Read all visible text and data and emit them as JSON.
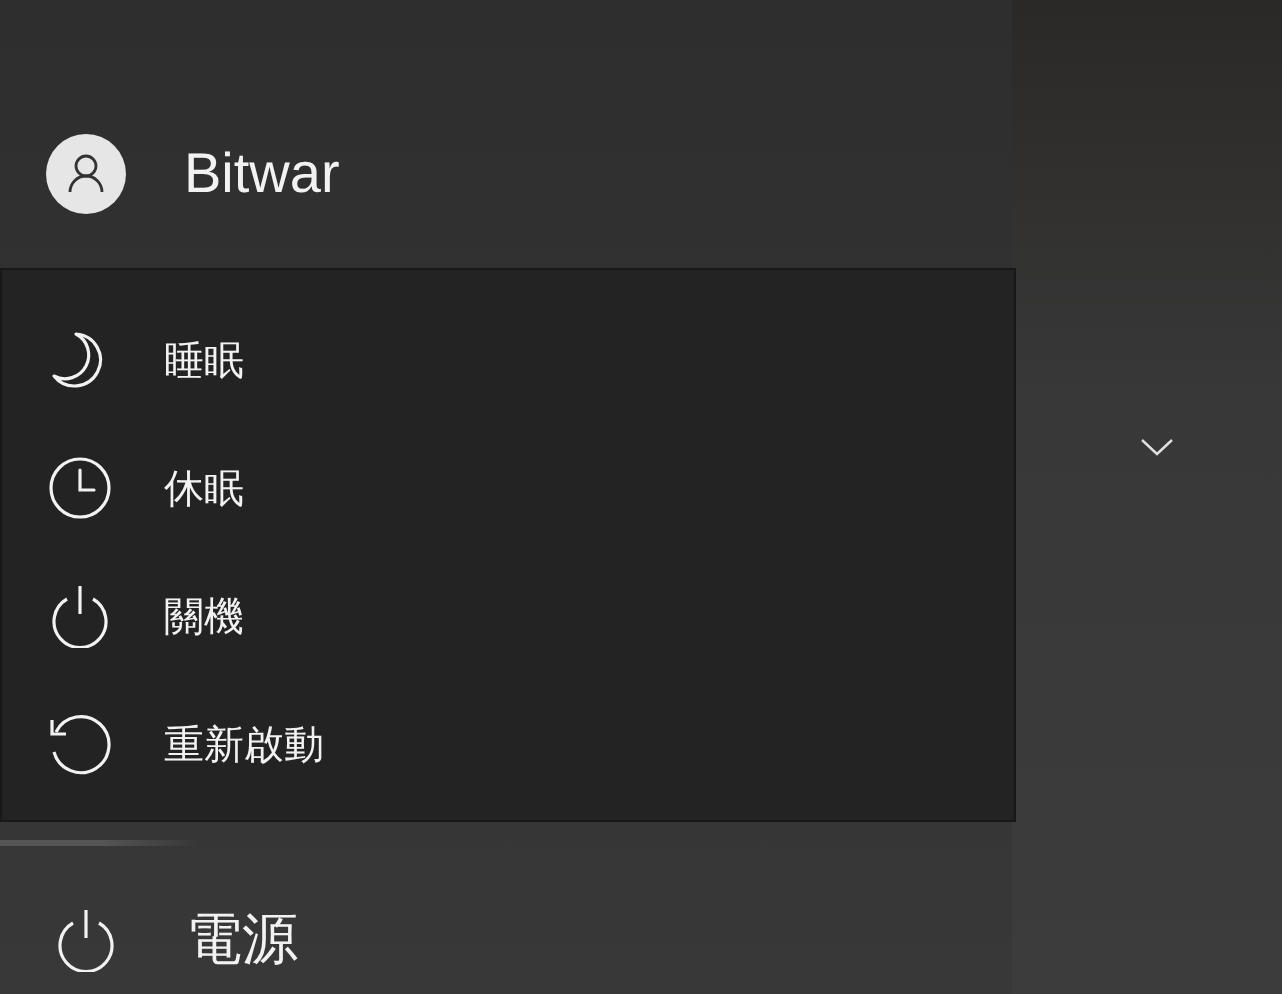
{
  "user": {
    "name": "Bitwar"
  },
  "power_menu": {
    "items": [
      {
        "kind": "sleep",
        "label": "睡眠"
      },
      {
        "kind": "hibernate",
        "label": "休眠"
      },
      {
        "kind": "shutdown",
        "label": "關機"
      },
      {
        "kind": "restart",
        "label": "重新啟動"
      }
    ]
  },
  "power": {
    "label": "電源"
  }
}
